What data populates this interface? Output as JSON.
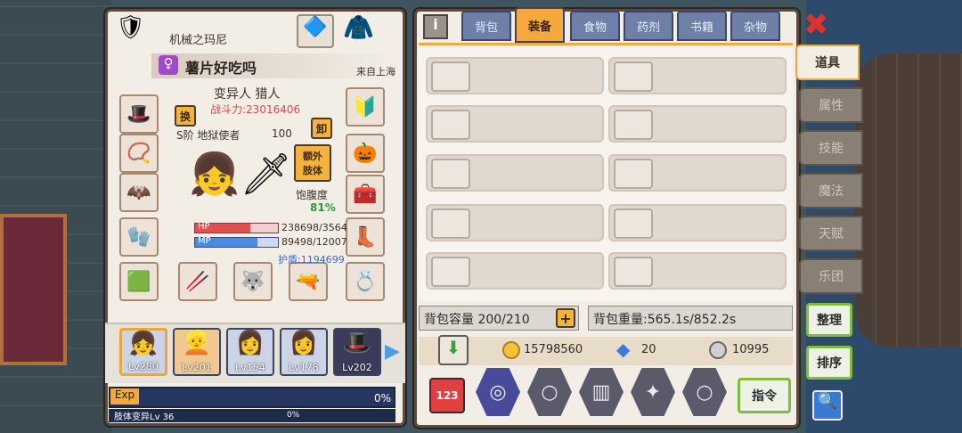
{
  "char": {
    "title": "机械之玛尼",
    "name": "薯片好吃吗",
    "origin": "来自上海",
    "class": "变异人 猎人",
    "power": "战斗力:23016406",
    "rank": "S阶 地狱使者",
    "rank_num": "100",
    "swap": "换",
    "unequip": "卸",
    "extra": "额外\n肢体",
    "hunger_label": "饱腹度",
    "hunger": "81%",
    "hp_label": "HP",
    "hp": "238698/3564",
    "mp_label": "MP",
    "mp": "89498/12007",
    "shield": "护盾:1194699",
    "exp_label": "Exp",
    "exp_pct": "0%",
    "mut": "肢体变异Lv 36",
    "mut_pct": "0%",
    "hp_frac": 0.67,
    "mp_frac": 0.75
  },
  "heroes": [
    {
      "lv": "Lv280"
    },
    {
      "lv": "Lv201"
    },
    {
      "lv": "Lv154"
    },
    {
      "lv": "Lv178"
    },
    {
      "lv": "Lv202"
    }
  ],
  "tabs": [
    "背包",
    "装备",
    "食物",
    "药剂",
    "书籍",
    "杂物"
  ],
  "info_icon": "i",
  "capacity": "背包容量 200/210",
  "capacity_plus": "+",
  "weight": "背包重量:565.1s/852.2s",
  "gold": "15798560",
  "diamond": "20",
  "coin": "10995",
  "sidetabs": [
    "道具",
    "属性",
    "技能",
    "魔法",
    "天赋",
    "乐团"
  ],
  "close": "✖",
  "sort1": "整理",
  "sort2": "排序",
  "cmd": "指令",
  "cmd_num": "123",
  "icons": {
    "gem": "◆",
    "search": "🔍"
  }
}
